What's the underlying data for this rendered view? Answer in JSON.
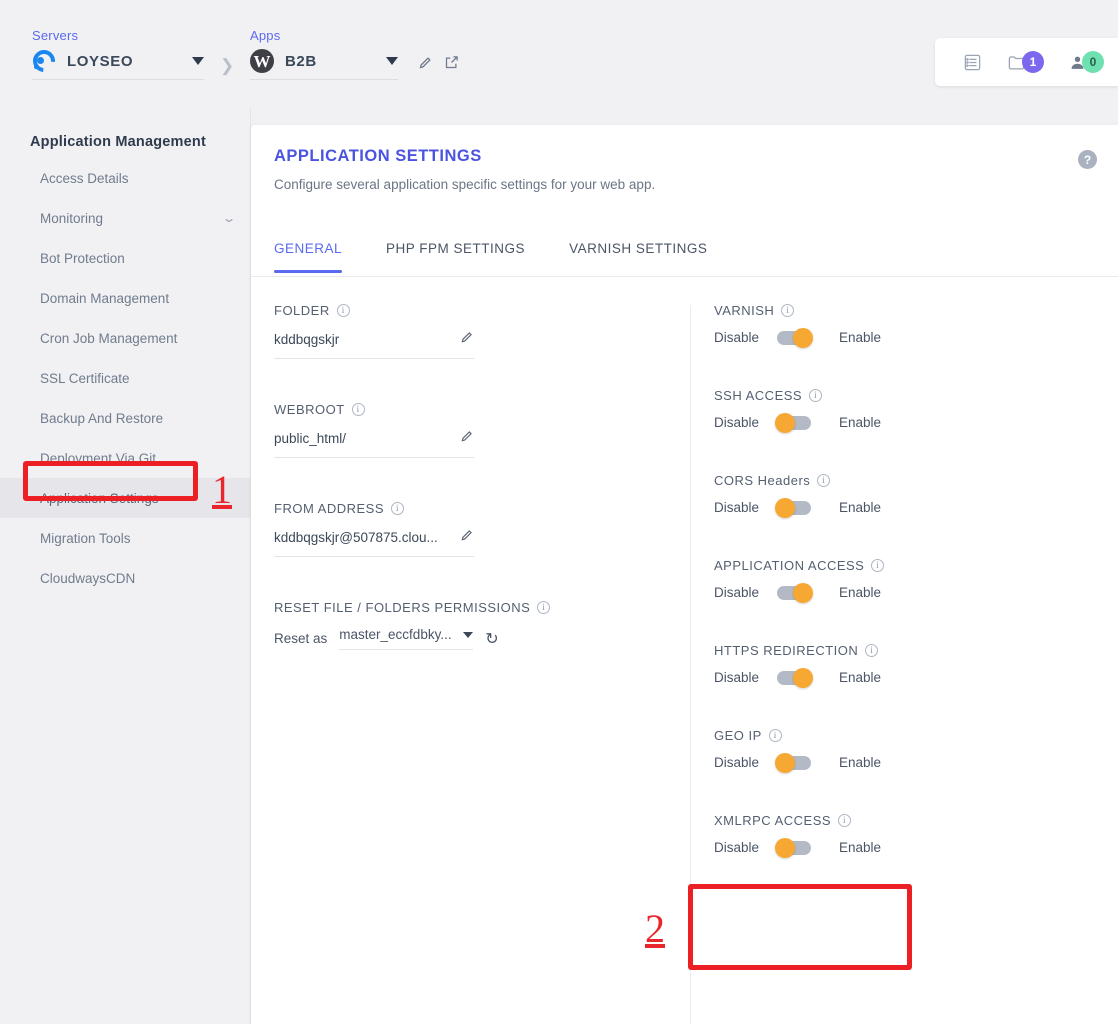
{
  "topbar": {
    "servers": {
      "label": "Servers",
      "name": "LOYSEO",
      "logo_icon": "cloudways-logo-icon",
      "caret_icon": "chevron-down-icon"
    },
    "separator_icon": "chevron-right-icon",
    "apps": {
      "label": "Apps",
      "name": "B2B",
      "logo_icon": "wordpress-icon",
      "caret_icon": "chevron-down-icon",
      "edit_icon": "pencil-icon",
      "open_icon": "external-link-icon"
    },
    "right_icons": {
      "list_icon": "list-icon",
      "folder_icon": "folder-icon",
      "folder_badge": "1",
      "user_icon": "user-icon",
      "user_badge": "0",
      "badge_purple": "#7b68ee",
      "badge_green": "#6fe0b0"
    }
  },
  "sidebar": {
    "title": "Application Management",
    "items": [
      {
        "label": "Access Details",
        "active": false,
        "chevron": false
      },
      {
        "label": "Monitoring",
        "active": false,
        "chevron": true
      },
      {
        "label": "Bot Protection",
        "active": false,
        "chevron": false
      },
      {
        "label": "Domain Management",
        "active": false,
        "chevron": false
      },
      {
        "label": "Cron Job Management",
        "active": false,
        "chevron": false
      },
      {
        "label": "SSL Certificate",
        "active": false,
        "chevron": false
      },
      {
        "label": "Backup And Restore",
        "active": false,
        "chevron": false
      },
      {
        "label": "Deployment Via Git",
        "active": false,
        "chevron": false
      },
      {
        "label": "Application Settings",
        "active": true,
        "chevron": false
      },
      {
        "label": "Migration Tools",
        "active": false,
        "chevron": false
      },
      {
        "label": "CloudwaysCDN",
        "active": false,
        "chevron": false
      }
    ]
  },
  "main": {
    "title": "APPLICATION SETTINGS",
    "subtitle": "Configure several application specific settings for your web app.",
    "help_icon": "?",
    "accent_color": "#5b6af0",
    "tabs": [
      {
        "label": "GENERAL",
        "active": true
      },
      {
        "label": "PHP FPM SETTINGS",
        "active": false
      },
      {
        "label": "VARNISH SETTINGS",
        "active": false
      }
    ],
    "left_fields": [
      {
        "label": "FOLDER",
        "value": "kddbqgskjr",
        "edit_icon": "pencil-icon",
        "info_icon": "info-icon"
      },
      {
        "label": "WEBROOT",
        "value": "public_html/",
        "edit_icon": "pencil-icon",
        "info_icon": "info-icon"
      },
      {
        "label": "FROM ADDRESS",
        "value": "kddbqgskjr@507875.clou...",
        "edit_icon": "pencil-icon",
        "info_icon": "info-icon"
      }
    ],
    "reset_section": {
      "label": "RESET FILE / FOLDERS PERMISSIONS",
      "info_icon": "info-icon",
      "prefix": "Reset as",
      "selected": "master_eccfdbky...",
      "caret_icon": "chevron-down-icon",
      "refresh_icon": "refresh-icon"
    },
    "toggle_off_label": "Disable",
    "toggle_on_label": "Enable",
    "toggle_knob_color": "#f6a833",
    "toggle_track_color": "#b3bac5",
    "toggles": [
      {
        "label": "VARNISH",
        "state": "on",
        "info_icon": "info-icon"
      },
      {
        "label": "SSH ACCESS",
        "state": "off",
        "info_icon": "info-icon"
      },
      {
        "label": "CORS Headers",
        "state": "off",
        "info_icon": "info-icon"
      },
      {
        "label": "APPLICATION ACCESS",
        "state": "on",
        "info_icon": "info-icon"
      },
      {
        "label": "HTTPS REDIRECTION",
        "state": "on",
        "info_icon": "info-icon"
      },
      {
        "label": "GEO IP",
        "state": "off",
        "info_icon": "info-icon"
      },
      {
        "label": "XMLRPC ACCESS",
        "state": "off",
        "info_icon": "info-icon"
      }
    ]
  },
  "annotations": {
    "color": "#ec2024",
    "marks": [
      {
        "number": "1",
        "target": "sidebar-item-application-settings"
      },
      {
        "number": "2",
        "target": "xmlrpc-access-toggle"
      }
    ]
  }
}
